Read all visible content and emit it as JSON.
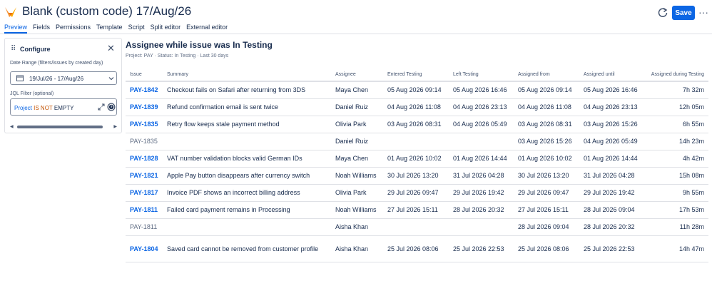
{
  "app": {
    "title": "Blank (custom code) 17/Aug/26",
    "save_label": "Save",
    "more_label": "···"
  },
  "tabs": [
    {
      "label": "Preview",
      "active": true
    },
    {
      "label": "Fields"
    },
    {
      "label": "Permissions"
    },
    {
      "label": "Template"
    },
    {
      "label": "Script"
    },
    {
      "label": "Split editor"
    },
    {
      "label": "External editor"
    }
  ],
  "config": {
    "title": "Configure",
    "date_range_label": "Date Range (filters/issues by created day)",
    "date_range_value": "19/Jul/26 - 17/Aug/26",
    "jql_label": "JQL Filter (optional)",
    "jql": {
      "field": "Project",
      "op": "IS NOT",
      "keyword": "EMPTY"
    },
    "help_label": "?"
  },
  "report": {
    "title": "Assignee while issue was In Testing",
    "meta": "Project: PAY  ·  Status: In Testing  ·  Last 30 days"
  },
  "table": {
    "headers": [
      "Issue",
      "Summary",
      "Assignee",
      "Entered Testing",
      "Left Testing",
      "Assigned from",
      "Assigned until",
      "Assigned during Testing"
    ],
    "rows": [
      {
        "issue": "PAY-1842",
        "linked": true,
        "summary": "Checkout fails on Safari after returning from 3DS",
        "assignee": "Maya Chen",
        "entered": "05 Aug 2026 09:14",
        "left": "05 Aug 2026 16:46",
        "from": "05 Aug 2026 09:14",
        "until": "05 Aug 2026 16:46",
        "duration": "7h 32m"
      },
      {
        "issue": "PAY-1839",
        "linked": true,
        "summary": "Refund confirmation email is sent twice",
        "assignee": "Daniel Ruiz",
        "entered": "04 Aug 2026 11:08",
        "left": "04 Aug 2026 23:13",
        "from": "04 Aug 2026 11:08",
        "until": "04 Aug 2026 23:13",
        "duration": "12h 05m"
      },
      {
        "issue": "PAY-1835",
        "linked": true,
        "summary": "Retry flow keeps stale payment method",
        "assignee": "Olivia Park",
        "entered": "03 Aug 2026 08:31",
        "left": "04 Aug 2026 05:49",
        "from": "03 Aug 2026 08:31",
        "until": "03 Aug 2026 15:26",
        "duration": "6h 55m"
      },
      {
        "issue": "PAY-1835",
        "linked": false,
        "summary": "",
        "assignee": "Daniel Ruiz",
        "entered": "",
        "left": "",
        "from": "03 Aug 2026 15:26",
        "until": "04 Aug 2026 05:49",
        "duration": "14h 23m"
      },
      {
        "issue": "PAY-1828",
        "linked": true,
        "summary": "VAT number validation blocks valid German IDs",
        "assignee": "Maya Chen",
        "entered": "01 Aug 2026 10:02",
        "left": "01 Aug 2026 14:44",
        "from": "01 Aug 2026 10:02",
        "until": "01 Aug 2026 14:44",
        "duration": "4h 42m"
      },
      {
        "issue": "PAY-1821",
        "linked": true,
        "summary": "Apple Pay button disappears after currency switch",
        "assignee": "Noah Williams",
        "entered": "30 Jul 2026 13:20",
        "left": "31 Jul 2026 04:28",
        "from": "30 Jul 2026 13:20",
        "until": "31 Jul 2026 04:28",
        "duration": "15h 08m"
      },
      {
        "issue": "PAY-1817",
        "linked": true,
        "summary": "Invoice PDF shows an incorrect billing address",
        "assignee": "Olivia Park",
        "entered": "29 Jul 2026 09:47",
        "left": "29 Jul 2026 19:42",
        "from": "29 Jul 2026 09:47",
        "until": "29 Jul 2026 19:42",
        "duration": "9h 55m"
      },
      {
        "issue": "PAY-1811",
        "linked": true,
        "summary": "Failed card payment remains in Processing",
        "assignee": "Noah Williams",
        "entered": "27 Jul 2026 15:11",
        "left": "28 Jul 2026 20:32",
        "from": "27 Jul 2026 15:11",
        "until": "28 Jul 2026 09:04",
        "duration": "17h 53m"
      },
      {
        "issue": "PAY-1811",
        "linked": false,
        "summary": "",
        "assignee": "Aisha Khan",
        "entered": "",
        "left": "",
        "from": "28 Jul 2026 09:04",
        "until": "28 Jul 2026 20:32",
        "duration": "11h 28m"
      },
      {
        "issue": "PAY-1804",
        "linked": true,
        "summary": "Saved card cannot be removed from customer profile",
        "assignee": "Aisha Khan",
        "entered": "25 Jul 2026 08:06",
        "left": "25 Jul 2026 22:53",
        "from": "25 Jul 2026 08:06",
        "until": "25 Jul 2026 22:53",
        "duration": "14h 47m"
      }
    ]
  }
}
